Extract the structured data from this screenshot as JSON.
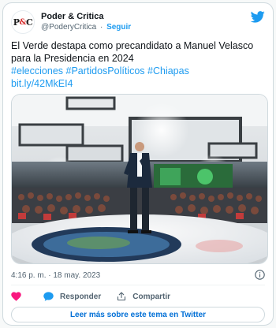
{
  "header": {
    "avatar_text_left": "P",
    "avatar_text_amp": "&",
    "avatar_text_right": "C",
    "author_name": "Poder & Critica",
    "handle": "@PoderyCritica",
    "separator": "·",
    "follow_label": "Seguir"
  },
  "tweet": {
    "text": "El Verde destapa como precandidato a Manuel Velasco para la Presidencia en 2024",
    "hashtags": "#elecciones #PartidosPolíticos #Chiapas",
    "link": "bit.ly/42MkEI4"
  },
  "media": {
    "description_icon": "photo"
  },
  "meta": {
    "time": "4:16 p. m. · 18 may. 2023"
  },
  "actions": {
    "reply_label": "Responder",
    "share_label": "Compartir"
  },
  "footer": {
    "read_more_label": "Leer más sobre este tema en Twitter"
  },
  "colors": {
    "accent": "#1d9bf0",
    "like": "#f91880",
    "link": "#006fd6",
    "muted": "#536471"
  }
}
